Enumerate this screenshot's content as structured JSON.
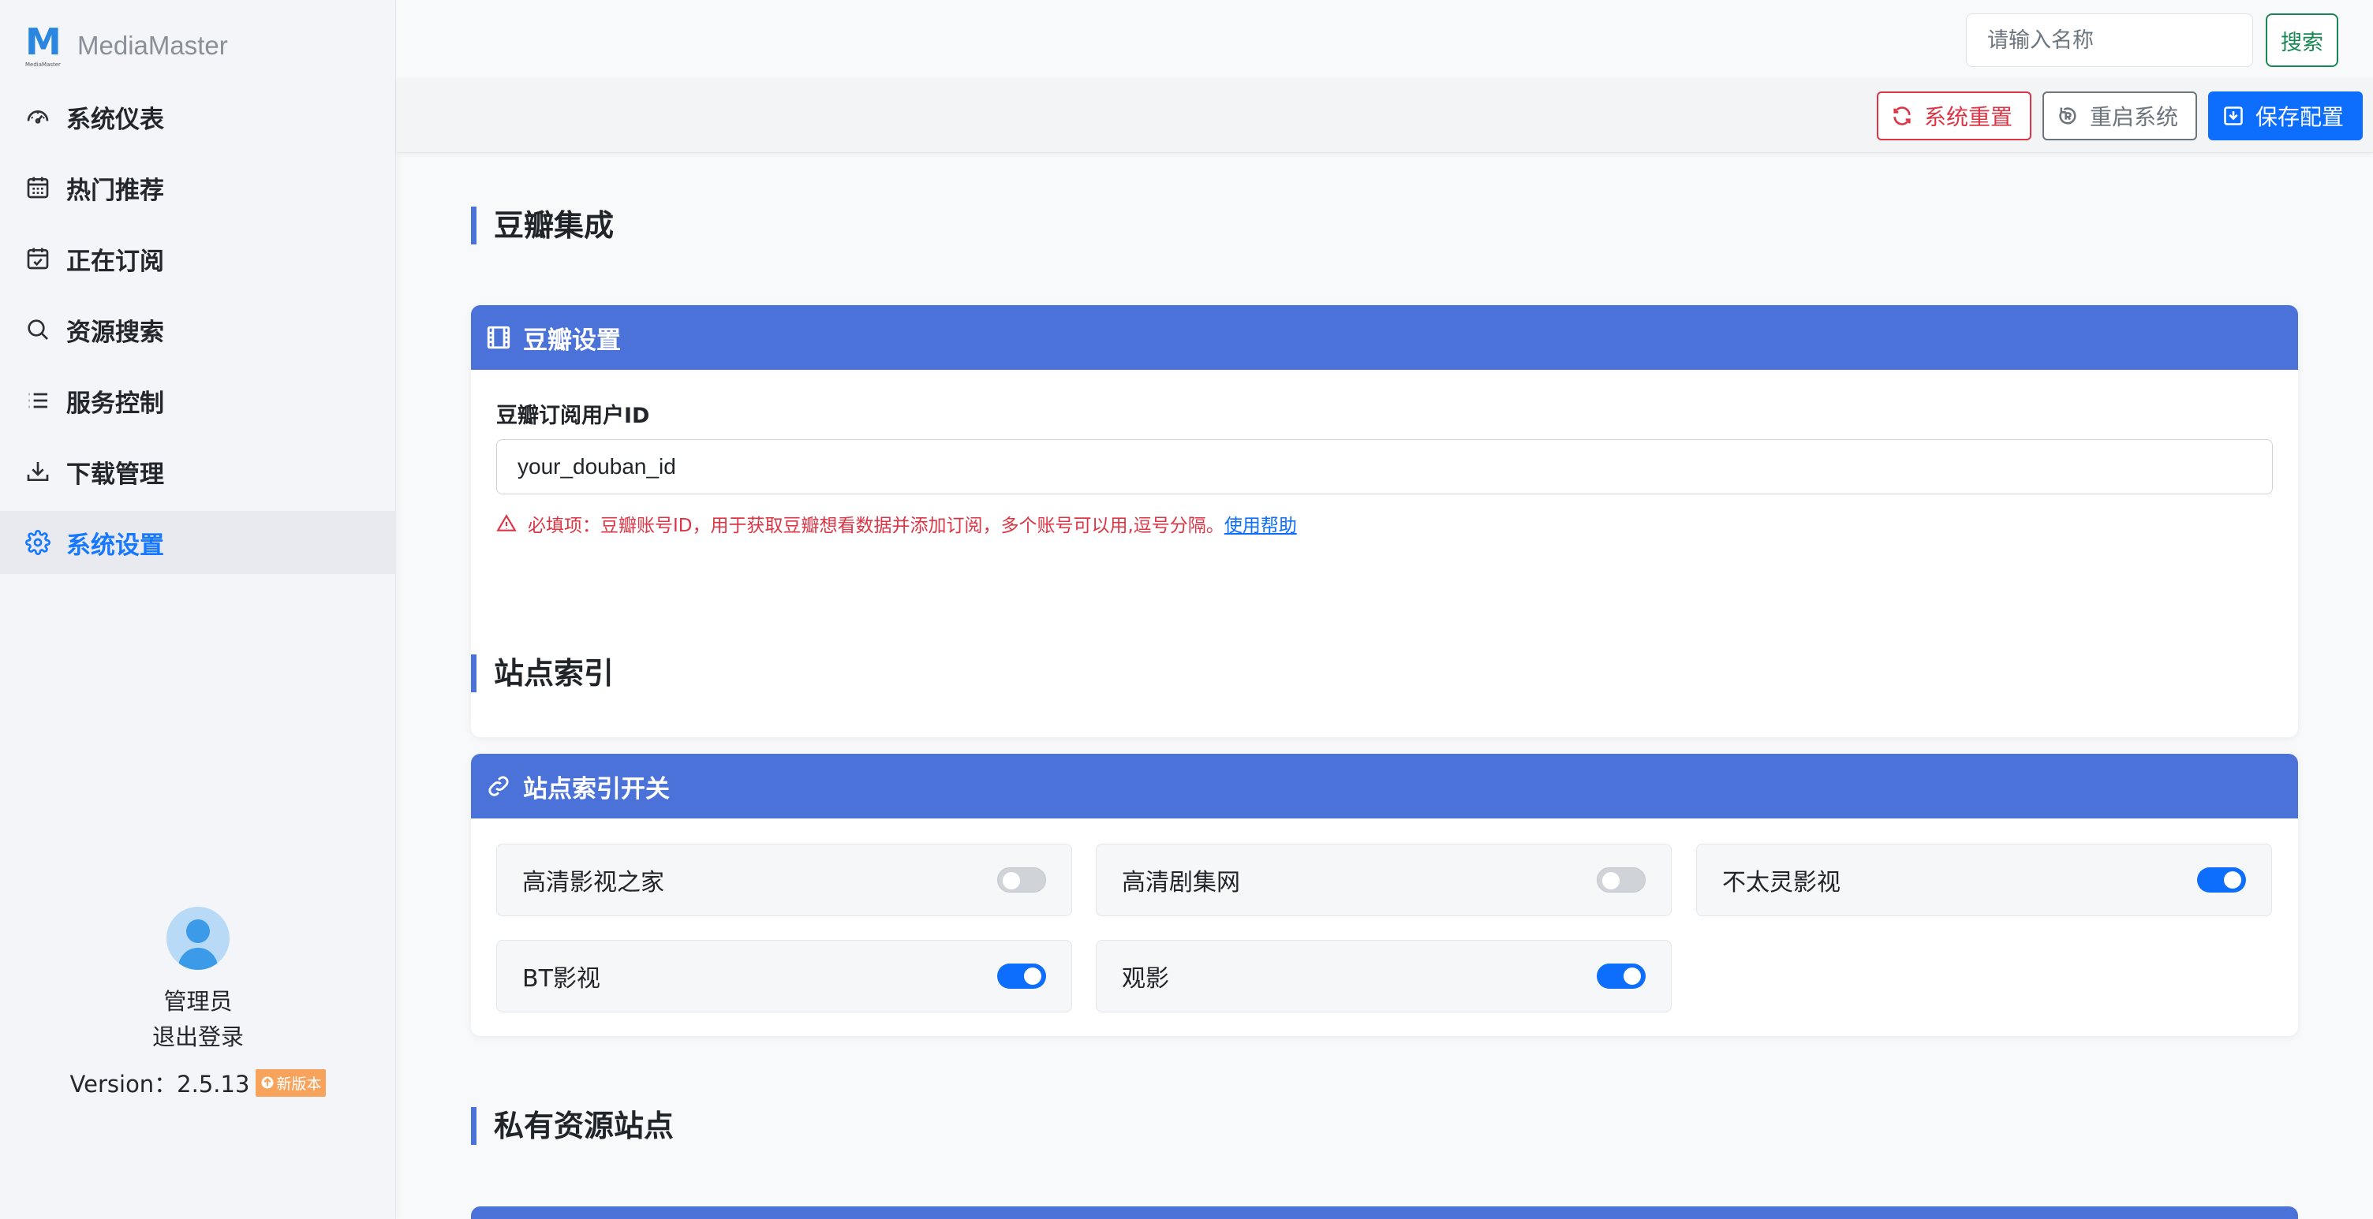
{
  "brand": {
    "logo_letter": "M",
    "logo_sub": "MediaMaster",
    "name": "MediaMaster"
  },
  "sidebar": {
    "items": [
      {
        "label": "系统仪表",
        "icon": "speedometer-icon",
        "active": false
      },
      {
        "label": "热门推荐",
        "icon": "calendar-grid-icon",
        "active": false
      },
      {
        "label": "正在订阅",
        "icon": "calendar-check-icon",
        "active": false
      },
      {
        "label": "资源搜索",
        "icon": "search-icon",
        "active": false
      },
      {
        "label": "服务控制",
        "icon": "list-icon",
        "active": false
      },
      {
        "label": "下载管理",
        "icon": "download-icon",
        "active": false
      },
      {
        "label": "系统设置",
        "icon": "gear-icon",
        "active": true
      }
    ],
    "user_name": "管理员",
    "logout_label": "退出登录",
    "version_text": "Version：2.5.13",
    "new_version_badge": "新版本"
  },
  "topbar": {
    "search_placeholder": "请输入名称",
    "search_button": "搜索"
  },
  "actions": {
    "reset_label": "系统重置",
    "restart_label": "重启系统",
    "save_label": "保存配置"
  },
  "sections": {
    "douban": {
      "title": "豆瓣集成",
      "card_title": "豆瓣设置",
      "field_label": "豆瓣订阅用户ID",
      "field_value": "your_douban_id",
      "hint_text": "必填项：豆瓣账号ID，用于获取豆瓣想看数据并添加订阅，多个账号可以用,逗号分隔。",
      "hint_link": "使用帮助"
    },
    "sites": {
      "title": "站点索引",
      "card_title": "站点索引开关",
      "toggles": [
        {
          "label": "高清影视之家",
          "on": false
        },
        {
          "label": "高清剧集网",
          "on": false
        },
        {
          "label": "不太灵影视",
          "on": true
        },
        {
          "label": "BT影视",
          "on": true
        },
        {
          "label": "观影",
          "on": true
        }
      ]
    },
    "private": {
      "title": "私有资源站点"
    }
  },
  "colors": {
    "accent": "#4a72d9",
    "primary": "#0d6efd",
    "danger": "#dc3545",
    "success": "#198754",
    "active_nav": "#1677ff"
  }
}
